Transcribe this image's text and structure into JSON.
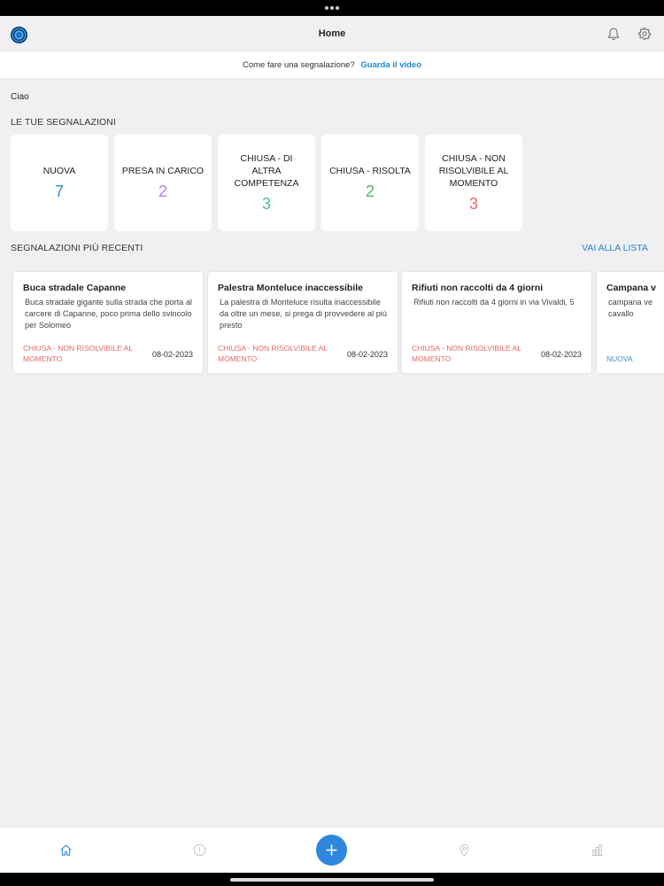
{
  "header": {
    "title": "Home"
  },
  "help": {
    "question": "Come fare una segnalazione?",
    "link": "Guarda il video"
  },
  "greeting": "Ciao",
  "my_reports": {
    "title": "LE TUE SEGNALAZIONI",
    "stats": [
      {
        "label": "NUOVA",
        "value": "7",
        "color": "#3a8fd1"
      },
      {
        "label": "PRESA IN CARICO",
        "value": "2",
        "color": "#b57fe0"
      },
      {
        "label": "CHIUSA - DI ALTRA COMPETENZA",
        "value": "3",
        "color": "#4cbf9b"
      },
      {
        "label": "CHIUSA - RISOLTA",
        "value": "2",
        "color": "#52b36c"
      },
      {
        "label": "CHIUSA - NON RISOLVIBILE AL MOMENTO",
        "value": "3",
        "color": "#e06a6a"
      }
    ]
  },
  "recent": {
    "title": "SEGNALAZIONI PIÙ RECENTI",
    "link": "VAI ALLA LISTA",
    "items": [
      {
        "title": "Buca stradale Capanne",
        "desc": "Buca stradale gigante sulla strada che porta al carcere di Capanne, poco prima dello svincolo per Solomeo",
        "status": "CHIUSA - NON RISOLVIBILE AL MOMENTO",
        "status_color": "#e06a6a",
        "date": "08-02-2023"
      },
      {
        "title": "Palestra Monteluce inaccessibile",
        "desc": "La palestra di Monteluce risulta inaccessibile da oltre un mese, si prega di provvedere al più presto",
        "status": "CHIUSA - NON RISOLVIBILE AL MOMENTO",
        "status_color": "#e06a6a",
        "date": "08-02-2023"
      },
      {
        "title": "Rifiuti non raccolti da 4 giorni",
        "desc": "Rifiuti non raccolti da 4 giorni in via Vivaldi, 5",
        "status": "CHIUSA - NON RISOLVIBILE AL MOMENTO",
        "status_color": "#e06a6a",
        "date": "08-02-2023"
      },
      {
        "title": "Campana v",
        "desc": "campana ve cavallo",
        "status": "NUOVA",
        "status_color": "#3a8fd1",
        "date": ""
      }
    ]
  },
  "tabs": [
    {
      "name": "home-icon",
      "color": "#2e87dc"
    },
    {
      "name": "info-icon",
      "color": "#c4c4c4"
    },
    {
      "name": "add-icon",
      "color": "#ffffff"
    },
    {
      "name": "map-pin-icon",
      "color": "#c4c4c4"
    },
    {
      "name": "stats-icon",
      "color": "#c4c4c4"
    }
  ]
}
